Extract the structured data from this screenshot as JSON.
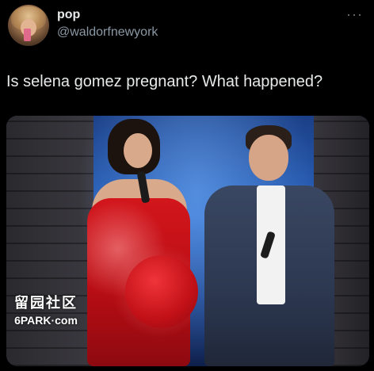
{
  "author": {
    "display_name": "pop",
    "handle": "@waldorfnewyork",
    "avatar_icon": "profile-photo"
  },
  "more_icon": "more-options-icon",
  "more_glyph": "···",
  "tweet": {
    "text": "Is selena gomez pregnant? What happened?"
  },
  "media": {
    "watermark": {
      "line1": "留园社区",
      "line2": "6PARK·com"
    }
  },
  "colors": {
    "background": "#000000",
    "primary_text": "#e7e9ea",
    "secondary_text": "#8b98a5",
    "dress_red": "#d2161c",
    "stage_blue": "#2b66c2"
  }
}
